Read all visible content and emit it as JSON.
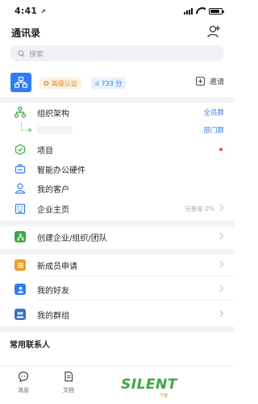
{
  "status_bar": {
    "time": "4:41",
    "time_arrow": "↗",
    "battery_level": 0.85
  },
  "header": {
    "title": "通讯录",
    "icon": "add-contact-icon"
  },
  "search": {
    "placeholder": "搜索",
    "icon": "search-icon"
  },
  "organization": {
    "logo_icon": "org-chart-icon",
    "level_badge": "高级认证",
    "member_count": "733 分",
    "invite_label": "邀请",
    "invite_icon": "invite-icon"
  },
  "org_section": {
    "structure": {
      "label": "组织架构",
      "right": "全员群",
      "icon": "org-tree-icon"
    },
    "sub_department": {
      "right": "部门群"
    },
    "items": [
      {
        "label": "项目",
        "icon": "project-icon",
        "has_dot": true
      },
      {
        "label": "智能办公硬件",
        "icon": "office-hardware-icon"
      },
      {
        "label": "我的客户",
        "icon": "customer-icon"
      },
      {
        "label": "企业主页",
        "icon": "company-home-icon",
        "right": "完善度 0%"
      }
    ]
  },
  "create": {
    "label": "创建企业/组织/团队",
    "icon": "create-org-icon"
  },
  "contacts": [
    {
      "label": "新成员申请",
      "icon": "new-member-icon",
      "color": "#f39a2b"
    },
    {
      "label": "我的好友",
      "icon": "friends-icon",
      "color": "#2f7cf6"
    },
    {
      "label": "我的群组",
      "icon": "groups-icon",
      "color": "#3b6fc9"
    }
  ],
  "frequent": {
    "title": "常用联系人"
  },
  "tabbar": [
    {
      "label": "消息",
      "icon": "message-icon"
    },
    {
      "label": "文档",
      "icon": "document-icon"
    }
  ],
  "watermark": {
    "text": "SILENT",
    "sub": "下载"
  },
  "colors": {
    "accent": "#2f7cf6",
    "green": "#3aa845",
    "orange": "#f39a2b",
    "divider": "#f2f3f5"
  }
}
